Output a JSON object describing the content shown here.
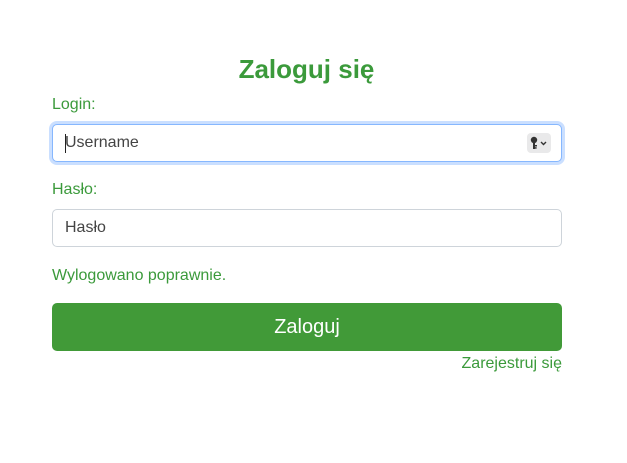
{
  "form": {
    "title": "Zaloguj się",
    "login_label": "Login:",
    "login_placeholder": "Username",
    "password_label": "Hasło:",
    "password_placeholder": "Hasło",
    "status_message": "Wylogowano poprawnie.",
    "submit_label": "Zaloguj",
    "register_link": "Zarejestruj się"
  },
  "icons": {
    "autofill": "key-icon",
    "autofill_menu": "chevron-down-icon"
  },
  "colors": {
    "accent": "#3b9a3b",
    "button_bg": "#419a38",
    "focus_border": "#86b7fe"
  }
}
